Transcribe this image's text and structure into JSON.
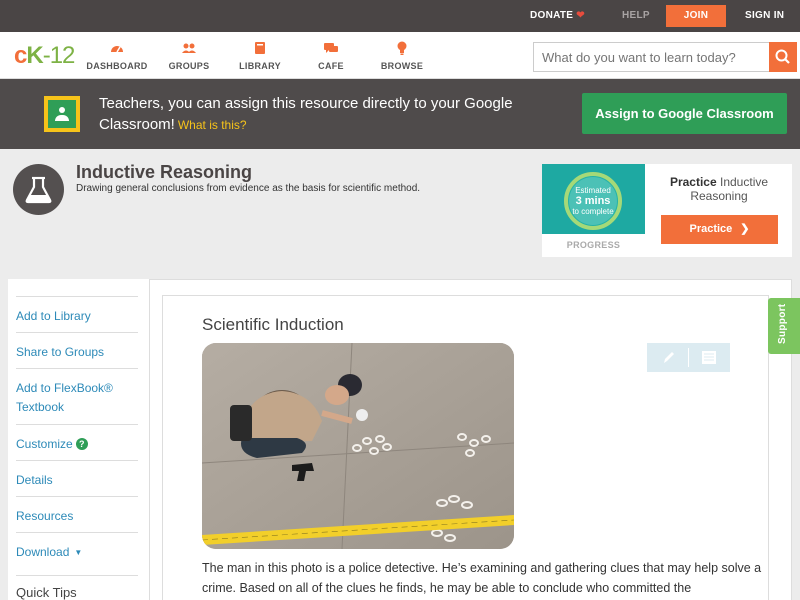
{
  "topbar": {
    "donate": "DONATE",
    "help": "HELP",
    "join": "JOIN",
    "signin": "SIGN IN"
  },
  "nav": {
    "logo_c": "c",
    "logo_k": "K",
    "logo_dash": "-",
    "logo_num": "12",
    "items": [
      {
        "label": "DASHBOARD",
        "icon": "dashboard-gauge-icon"
      },
      {
        "label": "GROUPS",
        "icon": "groups-people-icon"
      },
      {
        "label": "LIBRARY",
        "icon": "library-book-icon"
      },
      {
        "label": "CAFE",
        "icon": "cafe-chat-icon"
      },
      {
        "label": "BROWSE",
        "icon": "browse-lightbulb-icon"
      }
    ],
    "search_placeholder": "What do you want to learn today?"
  },
  "banner": {
    "text": "Teachers, you can assign this resource directly to your Google Classroom!",
    "what_is_this": "What is this?",
    "assign_button": "Assign to Google Classroom"
  },
  "concept": {
    "title": "Inductive Reasoning",
    "subtitle": "Drawing general conclusions from evidence as the basis for scientific method."
  },
  "practice": {
    "estimated_line1": "Estimated",
    "estimated_line2": "3 mins",
    "estimated_line3": "to complete",
    "progress_label": "PROGRESS",
    "practice_bold": "Practice",
    "practice_rest": "Inductive Reasoning",
    "practice_button": "Practice"
  },
  "sidebar": {
    "items": [
      {
        "label": "Add to Library"
      },
      {
        "label": "Share to Groups"
      },
      {
        "label": "Add to FlexBook® Textbook"
      },
      {
        "label": "Customize"
      },
      {
        "label": "Details"
      },
      {
        "label": "Resources"
      },
      {
        "label": "Download"
      }
    ],
    "quick_tips": "Quick Tips"
  },
  "article": {
    "title": "Scientific Induction",
    "paragraph": "The man in this photo is a police detective. He’s examining and gathering clues that may help solve a crime. Based on all of the clues he finds, he may be able to conclude who committed the"
  },
  "support_tab": "Support",
  "colors": {
    "accent_orange": "#f26f3a",
    "green": "#2f9e57",
    "link_blue": "#2d8ab8",
    "dark_bar": "#4a4545"
  }
}
